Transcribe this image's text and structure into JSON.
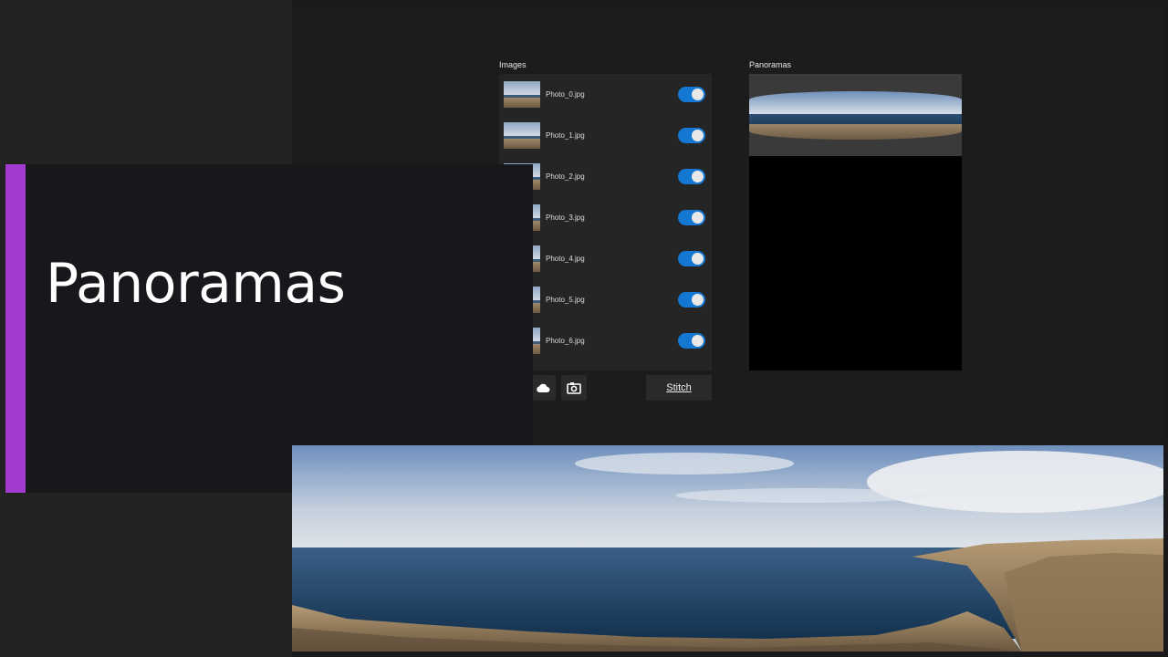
{
  "images_panel": {
    "label": "Images",
    "items": [
      {
        "file": "Photo_0.jpg",
        "enabled": true
      },
      {
        "file": "Photo_1.jpg",
        "enabled": true
      },
      {
        "file": "Photo_2.jpg",
        "enabled": true
      },
      {
        "file": "Photo_3.jpg",
        "enabled": true
      },
      {
        "file": "Photo_4.jpg",
        "enabled": true
      },
      {
        "file": "Photo_5.jpg",
        "enabled": true
      },
      {
        "file": "Photo_6.jpg",
        "enabled": true
      }
    ]
  },
  "toolbar": {
    "cloud_icon": "cloud-icon",
    "camera_icon": "camera-icon",
    "stitch_label": "Stitch"
  },
  "panoramas_panel": {
    "label": "Panoramas"
  },
  "title_card": {
    "title": "Panoramas",
    "accent_color": "#a43bd1"
  },
  "colors": {
    "toggle_on": "#1478d2",
    "background": "#1c1c1c"
  }
}
